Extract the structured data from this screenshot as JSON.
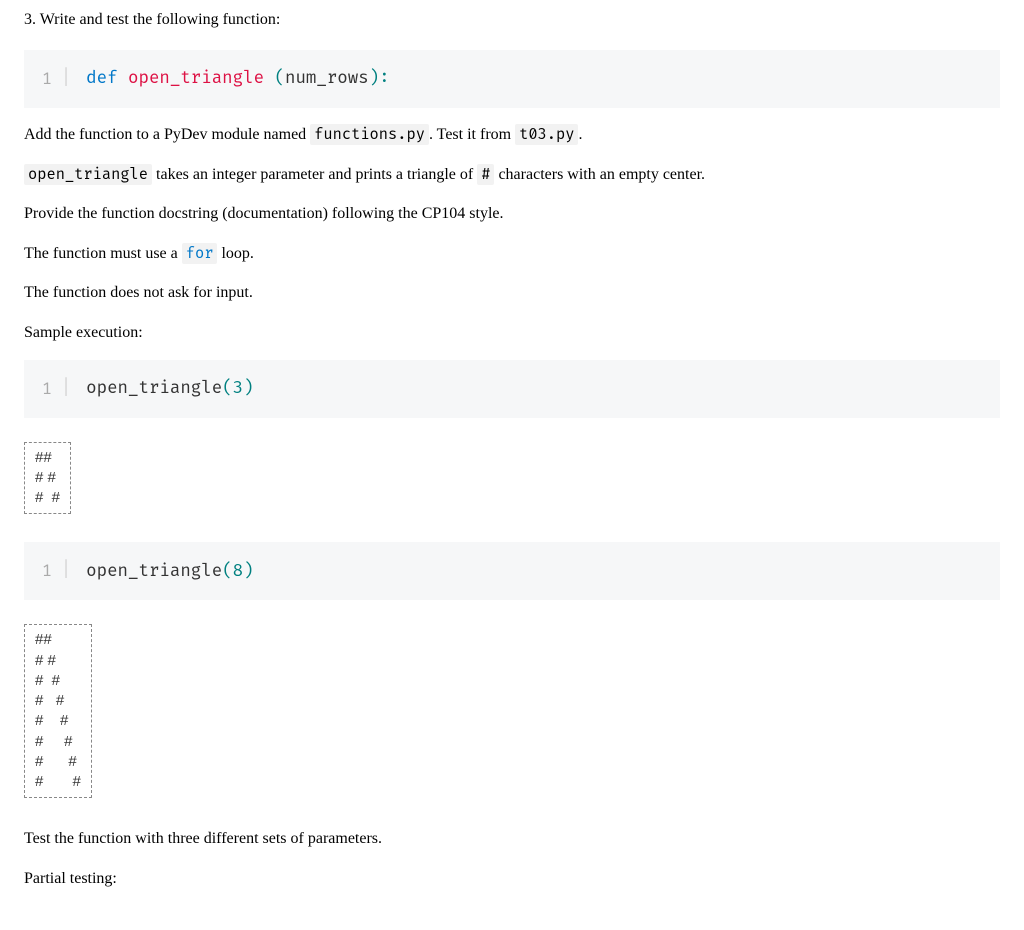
{
  "question": {
    "number": "3.",
    "prompt": "Write and test the following function:"
  },
  "code_def": {
    "line_num": "1",
    "kw": "def",
    "fn": "open_triangle",
    "open_paren": "(",
    "param": "num_rows",
    "close": "):"
  },
  "paragraphs": {
    "p1_pre": "Add the function to a PyDev module named ",
    "p1_mod": "functions.py",
    "p1_mid": ". Test it from ",
    "p1_test": "t03.py",
    "p1_end": ".",
    "p2_fn": "open_triangle",
    "p2_mid": " takes an integer parameter and prints a triangle of ",
    "p2_hash": "#",
    "p2_end": " characters with an empty center.",
    "p3": "Provide the function docstring (documentation) following the CP104 style.",
    "p4_pre": "The function must use a ",
    "p4_kw": "for",
    "p4_end": " loop.",
    "p5": "The function does not ask for input.",
    "p6": "Sample execution:",
    "p7": "Test the function with three different sets of parameters.",
    "p8": "Partial testing:"
  },
  "call1": {
    "line_num": "1",
    "fn": "open_triangle",
    "open": "(",
    "arg": "3",
    "close": ")"
  },
  "output1": "##\n# #\n#  #",
  "call2": {
    "line_num": "1",
    "fn": "open_triangle",
    "open": "(",
    "arg": "8",
    "close": ")"
  },
  "output2": "##\n# #\n#  #\n#   #\n#    #\n#     #\n#      #\n#       #"
}
